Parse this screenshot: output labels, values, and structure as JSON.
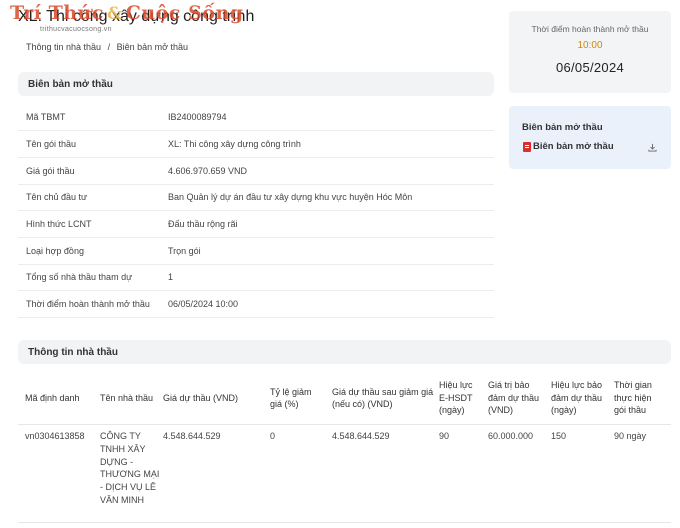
{
  "page_title": "XL: Thi công xây dựng công trình",
  "watermark": {
    "left": "Trí Thức",
    "amp": "&",
    "right": "Cuộc Sống",
    "sub": "trithucvacuocsong.vn"
  },
  "breadcrumb": [
    "Thông tin nhà thầu",
    "/",
    "Biên bản mở thầu"
  ],
  "opening_section": {
    "title": "Biên bản mở thầu",
    "rows": [
      {
        "label": "Mã TBMT",
        "value": "IB2400089794"
      },
      {
        "label": "Tên gói thầu",
        "value": "XL: Thi công xây dựng công trình"
      },
      {
        "label": "Giá gói thầu",
        "value": "4.606.970.659 VND"
      },
      {
        "label": "Tên chủ đầu tư",
        "value": "Ban Quản lý dự án đầu tư xây dựng khu vực huyện Hóc Môn"
      },
      {
        "label": "Hình thức LCNT",
        "value": "Đấu thầu rộng rãi"
      },
      {
        "label": "Loại hợp đồng",
        "value": "Trọn gói"
      },
      {
        "label": "Tổng số nhà thầu tham dự",
        "value": "1"
      },
      {
        "label": "Thời điểm hoàn thành mở thầu",
        "value": "06/05/2024 10:00"
      }
    ]
  },
  "time_card": {
    "label": "Thời điểm hoàn thành mở thầu",
    "time": "10:00",
    "date": "06/05/2024"
  },
  "doc_card": {
    "title": "Biên bản mở thầu",
    "file_label": "Biên bản mở thầu"
  },
  "contractor_section": {
    "title": "Thông tin nhà thầu",
    "columns": [
      "Mã định danh",
      "Tên nhà thầu",
      "Giá dự thầu (VND)",
      "Tỷ lệ giảm giá (%)",
      "Giá dự thầu sau giảm giá (nếu có) (VND)",
      "Hiệu lực E-HSDT (ngày)",
      "Giá trị bảo đảm dự thầu (VND)",
      "Hiệu lực bảo đảm dự thầu (ngày)",
      "Thời gian thực hiện gói thầu"
    ],
    "rows": [
      [
        "vn0304613858",
        "CÔNG TY TNHH XÂY DỰNG - THƯƠNG MẠI - DỊCH VỤ LÊ VĂN MINH",
        "4.548.644.529",
        "0",
        "4.548.644.529",
        "90",
        "60.000.000",
        "150",
        "90 ngày"
      ]
    ]
  }
}
